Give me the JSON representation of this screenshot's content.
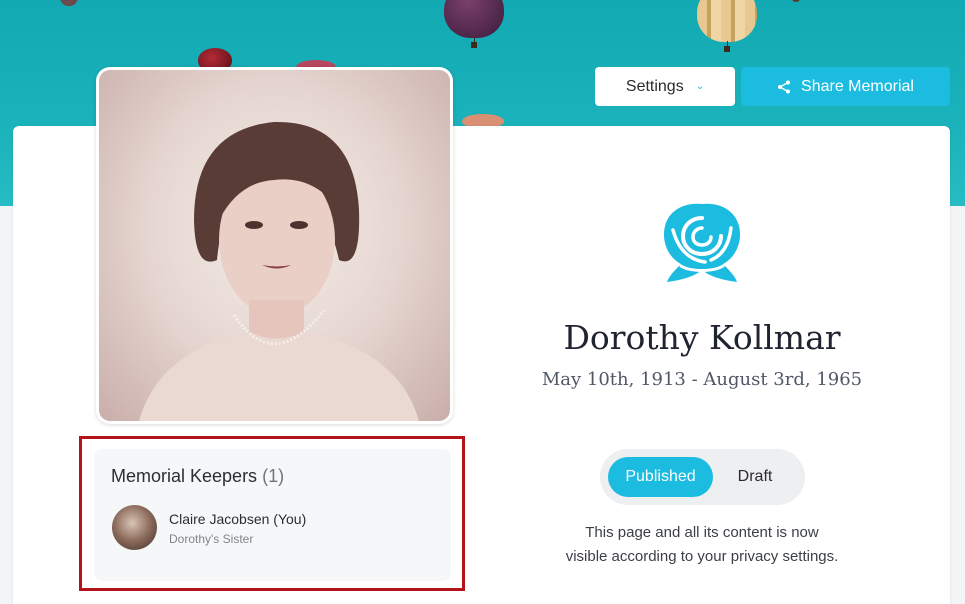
{
  "header": {
    "settings_label": "Settings",
    "share_label": "Share Memorial",
    "chevron_icon": "chevron-down-icon",
    "share_icon": "share-icon"
  },
  "memorial": {
    "name": "Dorothy Kollmar",
    "dates": "May 10th, 1913 - August 3rd, 1965",
    "emblem_icon": "rose-icon"
  },
  "status_toggle": {
    "options": [
      "Published",
      "Draft"
    ],
    "selected": "Published"
  },
  "status_note_line1": "This page and all its content is now",
  "status_note_line2": "visible according to your privacy settings.",
  "keepers": {
    "title": "Memorial Keepers",
    "count_text": "(1)",
    "list": [
      {
        "name": "Claire Jacobsen (You)",
        "relation": "Dorothy's Sister"
      }
    ]
  },
  "colors": {
    "accent": "#1cbbe0",
    "hero_sky": "#16adb7",
    "highlight_border": "#b3141b"
  }
}
